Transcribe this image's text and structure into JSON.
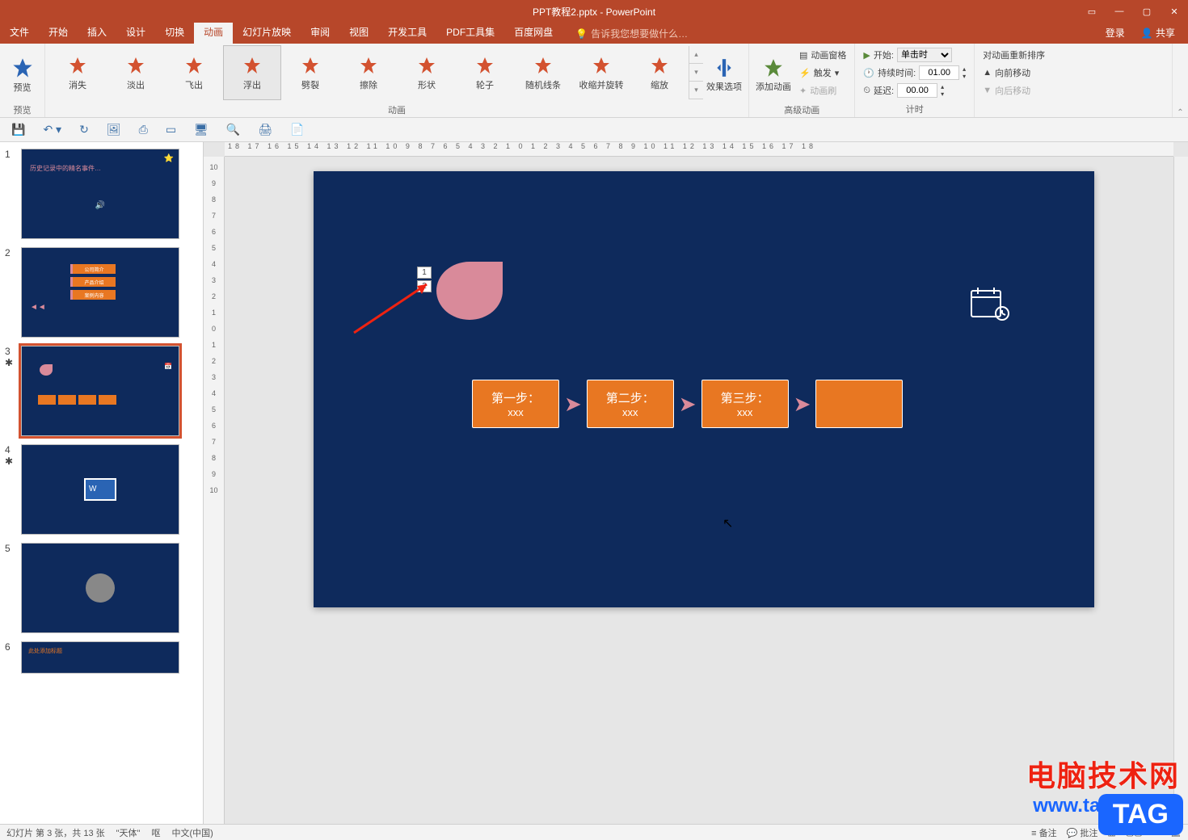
{
  "app": {
    "title": "PPT教程2.pptx - PowerPoint",
    "login": "登录",
    "share": "共享"
  },
  "tabs": {
    "file": "文件",
    "home": "开始",
    "insert": "插入",
    "design": "设计",
    "transitions": "切换",
    "animations": "动画",
    "slideshow": "幻灯片放映",
    "review": "审阅",
    "view": "视图",
    "developer": "开发工具",
    "pdf": "PDF工具集",
    "baidu": "百度网盘",
    "tell_me": "告诉我您想要做什么…"
  },
  "ribbon": {
    "preview": "预览",
    "preview_group": "预览",
    "anim": {
      "disappear": "消失",
      "fade": "淡出",
      "flyout": "飞出",
      "floatout": "浮出",
      "split": "劈裂",
      "wipe": "擦除",
      "shape": "形状",
      "wheel": "轮子",
      "randombars": "随机线条",
      "shrink": "收缩并旋转",
      "zoom": "缩放"
    },
    "anim_group": "动画",
    "effect_options": "效果选项",
    "add_anim": "添加动画",
    "anim_pane": "动画窗格",
    "trigger": "触发",
    "anim_painter": "动画刷",
    "adv_group": "高级动画",
    "start_label": "开始:",
    "start_value": "单击时",
    "duration_label": "持续时间:",
    "duration_value": "01.00",
    "delay_label": "延迟:",
    "delay_value": "00.00",
    "timing_group": "计时",
    "reorder": "对动画重新排序",
    "move_earlier": "向前移动",
    "move_later": "向后移动"
  },
  "slide": {
    "steps": {
      "s1_title": "第一步：",
      "s1_sub": "xxx",
      "s2_title": "第二步：",
      "s2_sub": "xxx",
      "s3_title": "第三步：",
      "s3_sub": "xxx"
    },
    "tag1": "1",
    "tag2": "2"
  },
  "thumbs": {
    "t1_title": "历史记录中的精名事件…",
    "t2_b1": "公司简介",
    "t2_b2": "产品介绍",
    "t2_b3": "案例内容",
    "t6_title": "此处添加标题"
  },
  "status": {
    "slide_info": "幻灯片 第 3 张，共 13 张",
    "theme": "\"天体\"",
    "lang_ind": "中文(中国)",
    "notes": "备注",
    "comments": "批注"
  },
  "watermark": {
    "zh": "电脑技术网",
    "url": "www.tagxp.com",
    "tag": "TAG"
  },
  "ruler_h": "18  17  16  15  14  13  12  11  10  9  8  7  6  5  4  3  2  1  0  1  2  3  4  5  6  7  8  9  10  11  12  13  14  15  16  17  18",
  "ruler_v_vals": [
    "10",
    "9",
    "8",
    "7",
    "6",
    "5",
    "4",
    "3",
    "2",
    "1",
    "0",
    "1",
    "2",
    "3",
    "4",
    "5",
    "6",
    "7",
    "8",
    "9",
    "10"
  ],
  "lang_btn": "呕"
}
